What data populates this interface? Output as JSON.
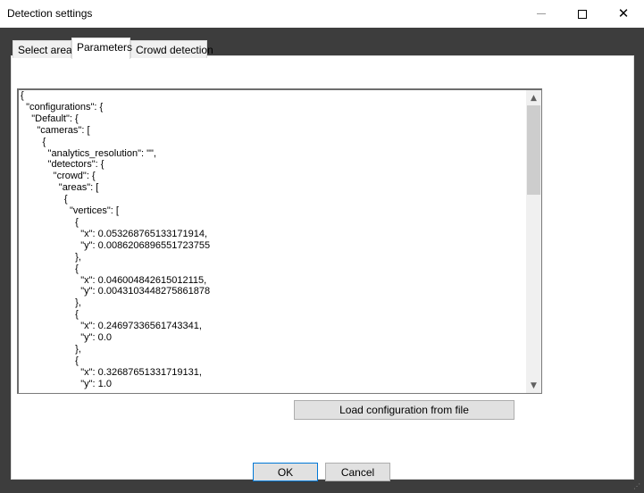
{
  "window": {
    "title": "Detection settings",
    "controls": {
      "minimize": "minimize",
      "maximize": "maximize",
      "close": "✕"
    }
  },
  "tabs": [
    {
      "label": "Select area",
      "selected": false
    },
    {
      "label": "Parameters",
      "selected": true
    },
    {
      "label": "Crowd detection",
      "selected": false
    }
  ],
  "config_text": "{\n  \"configurations\": {\n    \"Default\": {\n      \"cameras\": [\n        {\n          \"analytics_resolution\": \"\",\n          \"detectors\": {\n            \"crowd\": {\n              \"areas\": [\n                {\n                  \"vertices\": [\n                    {\n                      \"x\": 0.053268765133171914,\n                      \"y\": 0.0086206896551723755\n                    },\n                    {\n                      \"x\": 0.046004842615012115,\n                      \"y\": 0.0043103448275861878\n                    },\n                    {\n                      \"x\": 0.24697336561743341,\n                      \"y\": 0.0\n                    },\n                    {\n                      \"x\": 0.32687651331719131,\n                      \"y\": 1.0",
  "buttons": {
    "load_config": "Load configuration from file",
    "ok": "OK",
    "cancel": "Cancel"
  },
  "colors": {
    "dialog_bg": "#3d3d3d",
    "panel_bg": "#ffffff",
    "button_bg": "#e1e1e1",
    "focus_border": "#0078d7"
  }
}
